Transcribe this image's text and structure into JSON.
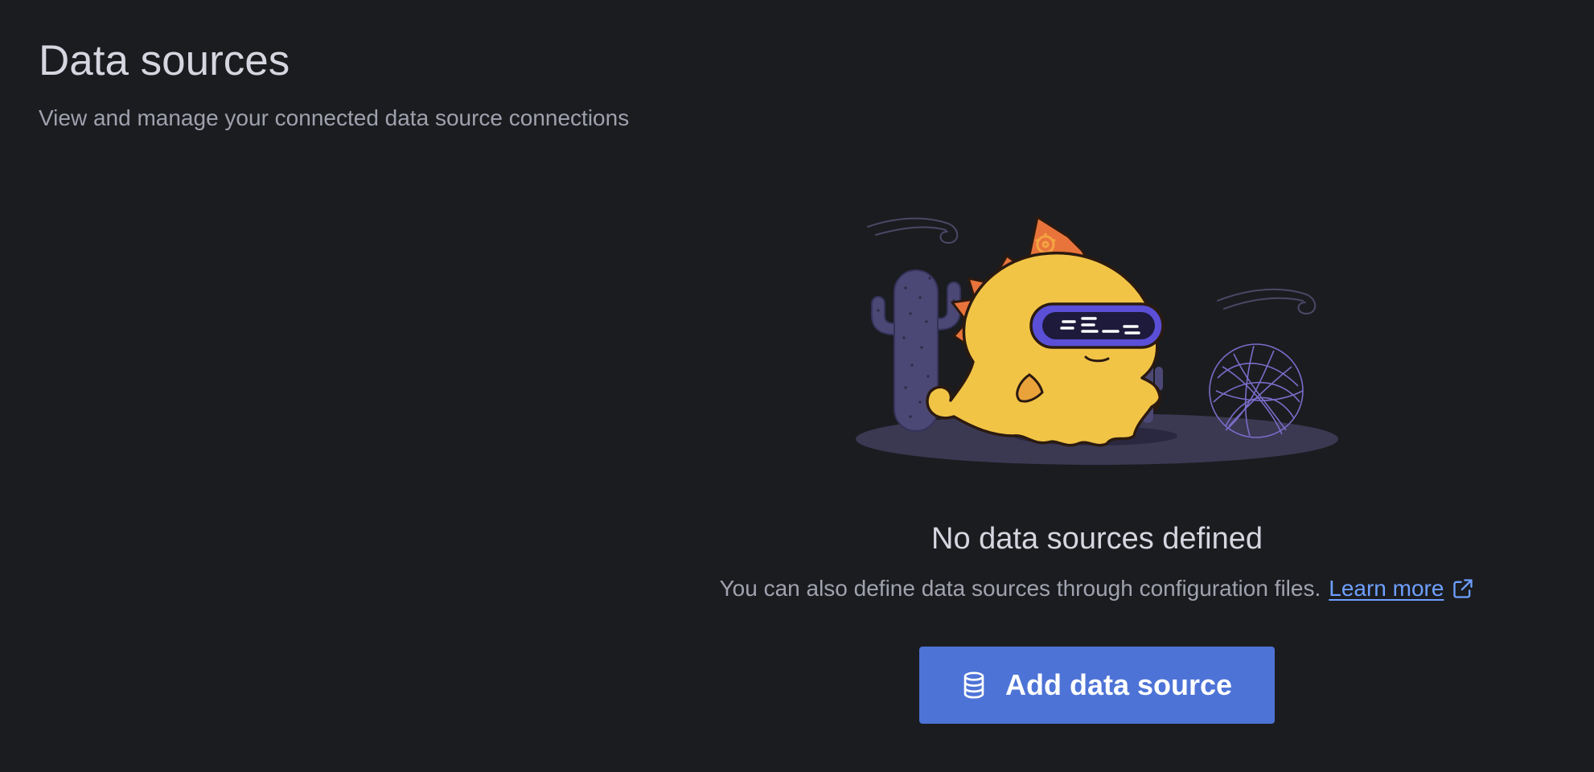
{
  "header": {
    "title": "Data sources",
    "subtitle": "View and manage your connected data source connections"
  },
  "empty_state": {
    "illustration": "grafana-mascot-desert-illustration",
    "title": "No data sources defined",
    "description": "You can also define data sources through configuration files.",
    "learn_more_label": "Learn more",
    "learn_more_icon": "external-link-icon",
    "button_label": "Add data source",
    "button_icon": "database-icon"
  },
  "colors": {
    "background": "#1b1c20",
    "primary": "#4d73d6",
    "link": "#6e9fff",
    "mascot_body": "#f2c446",
    "mascot_crest": "#e8743b",
    "visor": "#5a4fd6"
  }
}
